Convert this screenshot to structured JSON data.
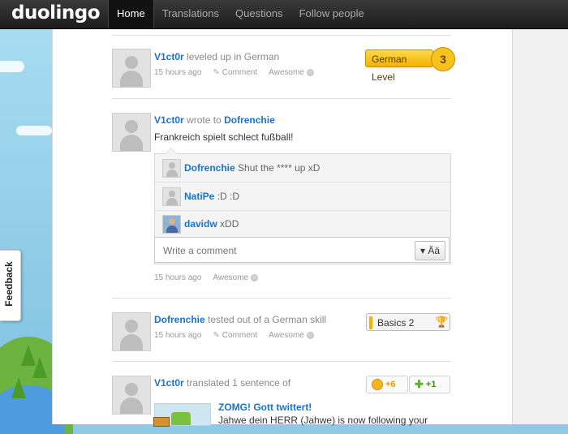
{
  "app": {
    "logo": "duolingo"
  },
  "nav": {
    "items": [
      "Home",
      "Translations",
      "Questions",
      "Follow people"
    ]
  },
  "sidebar": {
    "feedback_label": "Feedback"
  },
  "feed": {
    "item1": {
      "user": "V1ct0r",
      "action": "leveled up in German",
      "time": "15 hours ago",
      "comment_label": "Comment",
      "awesome_label": "Awesome",
      "badge_label": "German Level",
      "badge_level": "3"
    },
    "item2": {
      "user": "V1ct0r",
      "action": "wrote to",
      "target": "Dofrenchie",
      "message": "Frankreich spielt schlect fußball!",
      "comments": [
        {
          "user": "Dofrenchie",
          "text": "Shut the **** up xD"
        },
        {
          "user": "NatiPe",
          "text": ":D :D"
        },
        {
          "user": "davidw",
          "text": "xDD"
        }
      ],
      "comment_placeholder": "Write a comment",
      "char_button": "Ää",
      "time": "15 hours ago",
      "awesome_label": "Awesome"
    },
    "item3": {
      "user": "Dofrenchie",
      "action": "tested out of a German skill",
      "time": "15 hours ago",
      "comment_label": "Comment",
      "awesome_label": "Awesome",
      "skill_label": "Basics 2"
    },
    "item4": {
      "user": "V1ct0r",
      "action": "translated 1 sentence of",
      "coins": "+6",
      "skill_points": "+1",
      "doc_title": "ZOMG! Gott twittert!",
      "doc_snippet": "Jahwe dein HERR (Jahwe) is now following your"
    }
  }
}
